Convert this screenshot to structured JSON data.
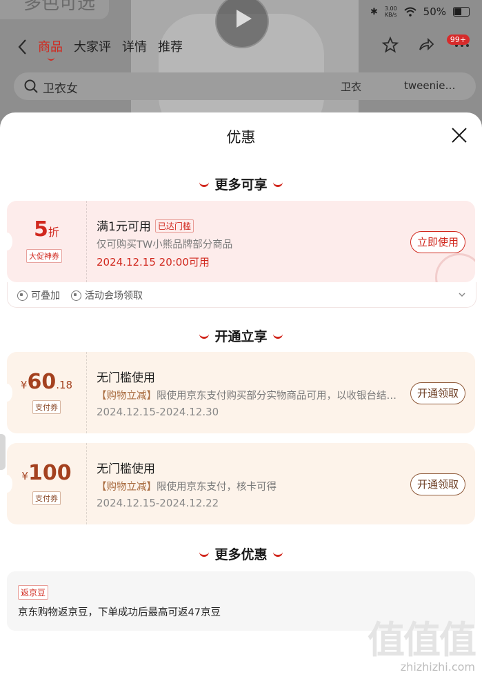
{
  "background": {
    "title_chip": "多色可选",
    "status": {
      "speed": "3.00\nKB/s",
      "battery": "50%"
    },
    "tabs": [
      "商品",
      "大家评",
      "详情",
      "推荐"
    ],
    "badge": "99+",
    "search": {
      "query": "卫衣女",
      "chip1": "卫衣",
      "chip2": "tweenie…"
    }
  },
  "sheet": {
    "title": "优惠",
    "sections": {
      "more_enjoy": "更多可享",
      "open_enjoy": "开通立享",
      "more_offers": "更多优惠"
    }
  },
  "coupon1": {
    "value": "5",
    "unit": "折",
    "tag": "大促神券",
    "title": "满1元可用",
    "reached": "已达门槛",
    "desc": "仅可购买TW小熊品牌部分商品",
    "date": "2024.12.15 20:00可用",
    "action": "立即使用",
    "foot1": "可叠加",
    "foot2": "活动会场领取"
  },
  "coupon2": {
    "yen": "¥",
    "int": "60",
    "dec": ".18",
    "tag": "支付券",
    "title": "无门槛使用",
    "desc_hl": "【购物立减】",
    "desc": "限使用京东支付购买部分实物商品可用，以收银台结…",
    "date": "2024.12.15-2024.12.30",
    "action": "开通领取"
  },
  "coupon3": {
    "yen": "¥",
    "int": "100",
    "tag": "支付券",
    "title": "无门槛使用",
    "desc_hl": "【购物立减】",
    "desc": "限使用京东支付，核卡可得",
    "date": "2024.12.15-2024.12.22",
    "action": "开通领取"
  },
  "more_offer": {
    "tag": "返京豆",
    "text": "京东购物返京豆，下单成功后最高可返47京豆"
  },
  "watermark": {
    "logo": "值值值",
    "url": "zhizhizhi.com"
  },
  "colors": {
    "accent": "#d1281e",
    "pay_brown": "#a4411f"
  }
}
